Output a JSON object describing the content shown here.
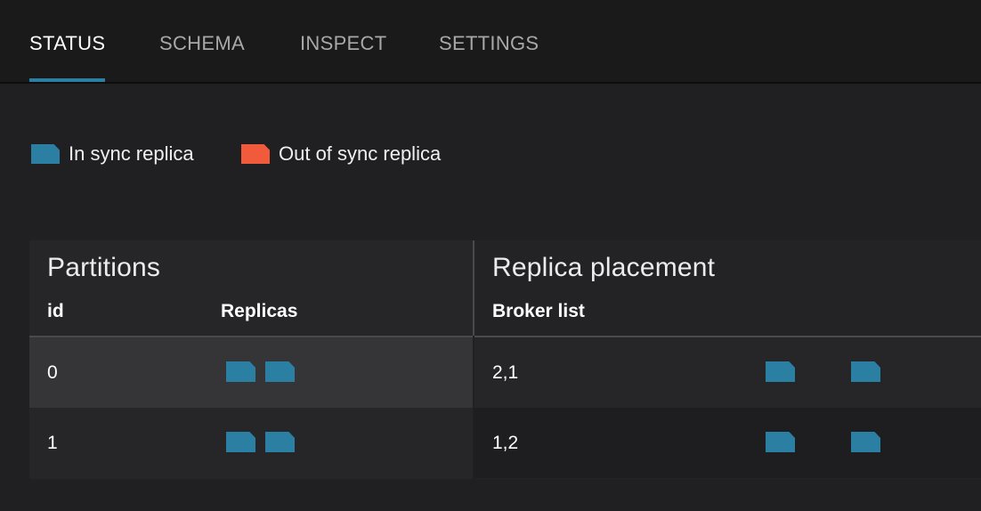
{
  "tabs": [
    {
      "label": "STATUS",
      "active": true
    },
    {
      "label": "SCHEMA",
      "active": false
    },
    {
      "label": "INSPECT",
      "active": false
    },
    {
      "label": "SETTINGS",
      "active": false
    }
  ],
  "legend": {
    "in_sync": {
      "label": "In sync replica",
      "color": "#2a7fa3"
    },
    "out_of_sync": {
      "label": "Out of sync replica",
      "color": "#f15a3b"
    }
  },
  "partitions": {
    "title": "Partitions",
    "columns": {
      "id": "id",
      "replicas": "Replicas"
    },
    "rows": [
      {
        "id": "0",
        "replicas": [
          "in-sync",
          "in-sync"
        ]
      },
      {
        "id": "1",
        "replicas": [
          "in-sync",
          "in-sync"
        ]
      }
    ]
  },
  "placement": {
    "title": "Replica placement",
    "columns": {
      "broker_list": "Broker list"
    },
    "rows": [
      {
        "broker_list": "2,1",
        "brokers": [
          "in-sync",
          "in-sync"
        ]
      },
      {
        "broker_list": "1,2",
        "brokers": [
          "in-sync",
          "in-sync"
        ]
      }
    ]
  }
}
